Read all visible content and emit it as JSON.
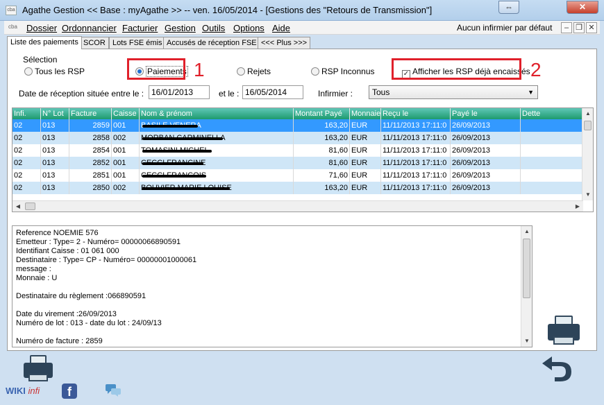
{
  "window": {
    "icon_label": "cba",
    "title": "Agathe Gestion << Base : myAgathe >>   --   ven. 16/05/2014  -  [Gestions des \"Retours de Transmission\"]",
    "btn_restore": "⇔",
    "btn_minimize": "–",
    "btn_close": "✕"
  },
  "menubar": {
    "doc_icon": "cba",
    "items": [
      "Dossier",
      "Ordonnancier",
      "Facturier",
      "Gestion",
      "Outils",
      "Options",
      "Aide"
    ],
    "default_nurse": "Aucun infirmier par défaut",
    "mdi_minimize": "–",
    "mdi_restore": "❐",
    "mdi_close": "✕"
  },
  "tabs": [
    "Liste des paiements",
    "SCOR",
    "Lots FSE émis",
    "Accusés de réception FSE",
    "<<< Plus >>>"
  ],
  "filters": {
    "section_label": "Sélection",
    "radios": [
      "Tous les RSP",
      "Paiements",
      "Rejets",
      "RSP Inconnus"
    ],
    "selected_radio": "Paiements",
    "checkbox_label": "Afficher les RSP déjà encaissés",
    "checkbox_checked": true,
    "date_label": "Date de réception située entre le :",
    "date_from": "16/01/2013",
    "and_label": "et le :",
    "date_to": "16/05/2014",
    "nurse_label": "Infirmier :",
    "nurse_value": "Tous"
  },
  "annotations": {
    "first": "1",
    "second": "2"
  },
  "colors": {
    "header_green": "#1e9a6d",
    "selected_row": "#3399ff",
    "alt_row": "#cfe6f7",
    "annotation_red": "#e0202a"
  },
  "table": {
    "columns": [
      "Infi.",
      "N° Lot",
      "Facture",
      "Caisse",
      "Nom & prénom",
      "Montant Payé",
      "Monnaie",
      "Reçu le",
      "Payé le",
      "Dette"
    ],
    "rows": [
      [
        "02",
        "013",
        "2859",
        "001",
        "BASILE VENERA",
        "163,20",
        "EUR",
        "11/11/2013 17:11:0",
        "26/09/2013",
        ""
      ],
      [
        "02",
        "013",
        "2858",
        "002",
        "MORBAN CARMINELLA",
        "163,20",
        "EUR",
        "11/11/2013 17:11:0",
        "26/09/2013",
        ""
      ],
      [
        "02",
        "013",
        "2854",
        "001",
        "TOMASINI MICHEL",
        "81,60",
        "EUR",
        "11/11/2013 17:11:0",
        "26/09/2013",
        ""
      ],
      [
        "02",
        "013",
        "2852",
        "001",
        "CECCI FRANCINE",
        "81,60",
        "EUR",
        "11/11/2013 17:11:0",
        "26/09/2013",
        ""
      ],
      [
        "02",
        "013",
        "2851",
        "001",
        "CECCI FRANCOIS",
        "71,60",
        "EUR",
        "11/11/2013 17:11:0",
        "26/09/2013",
        ""
      ],
      [
        "02",
        "013",
        "2850",
        "002",
        "BOUVIER MARIE LOUISE",
        "163,20",
        "EUR",
        "11/11/2013 17:11:0",
        "26/09/2013",
        ""
      ]
    ]
  },
  "detail": {
    "lines": [
      "Reference NOEMIE 576",
      "Emetteur : Type= 2 -  Numéro= 00000066890591",
      "Identifiant Caisse : 01 061 000",
      "Destinataire : Type= CP - Numéro= 00000001000061",
      "message :",
      "Monnaie : U",
      "",
      "Destinataire du règlement :066890591",
      "",
      "Date du virement :26/09/2013",
      "Numéro de lot : 013 - date du lot : 24/09/13",
      "",
      "Numéro de facture : 2859"
    ]
  },
  "footer": {
    "wiki": "WIKI",
    "infi": "infi",
    "fb": "f"
  }
}
